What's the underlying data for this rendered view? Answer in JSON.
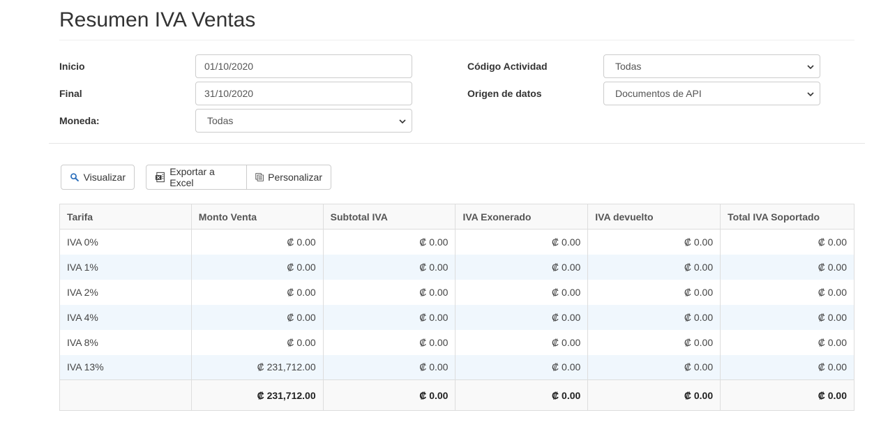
{
  "page": {
    "title": "Resumen IVA Ventas"
  },
  "filters": {
    "inicio": {
      "label": "Inicio",
      "value": "01/10/2020"
    },
    "final": {
      "label": "Final",
      "value": "31/10/2020"
    },
    "moneda": {
      "label": "Moneda:",
      "value": "Todas"
    },
    "codigo_actividad": {
      "label": "Código Actividad",
      "value": "Todas"
    },
    "origen_datos": {
      "label": "Origen de datos",
      "value": "Documentos de API"
    }
  },
  "buttons": {
    "visualizar": "Visualizar",
    "exportar": "Exportar a Excel",
    "personalizar": "Personalizar"
  },
  "icons": {
    "visualizar": "search-icon",
    "exportar": "excel-icon",
    "personalizar": "columns-icon"
  },
  "table": {
    "headers": [
      "Tarifa",
      "Monto Venta",
      "Subtotal IVA",
      "IVA Exonerado",
      "IVA devuelto",
      "Total IVA Soportado"
    ],
    "rows": [
      [
        "IVA 0%",
        "₡ 0.00",
        "₡ 0.00",
        "₡ 0.00",
        "₡ 0.00",
        "₡ 0.00"
      ],
      [
        "IVA 1%",
        "₡ 0.00",
        "₡ 0.00",
        "₡ 0.00",
        "₡ 0.00",
        "₡ 0.00"
      ],
      [
        "IVA 2%",
        "₡ 0.00",
        "₡ 0.00",
        "₡ 0.00",
        "₡ 0.00",
        "₡ 0.00"
      ],
      [
        "IVA 4%",
        "₡ 0.00",
        "₡ 0.00",
        "₡ 0.00",
        "₡ 0.00",
        "₡ 0.00"
      ],
      [
        "IVA 8%",
        "₡ 0.00",
        "₡ 0.00",
        "₡ 0.00",
        "₡ 0.00",
        "₡ 0.00"
      ],
      [
        "IVA 13%",
        "₡ 231,712.00",
        "₡ 0.00",
        "₡ 0.00",
        "₡ 0.00",
        "₡ 0.00"
      ]
    ],
    "totals": [
      "",
      "₡ 231,712.00",
      "₡ 0.00",
      "₡ 0.00",
      "₡ 0.00",
      "₡ 0.00"
    ]
  }
}
